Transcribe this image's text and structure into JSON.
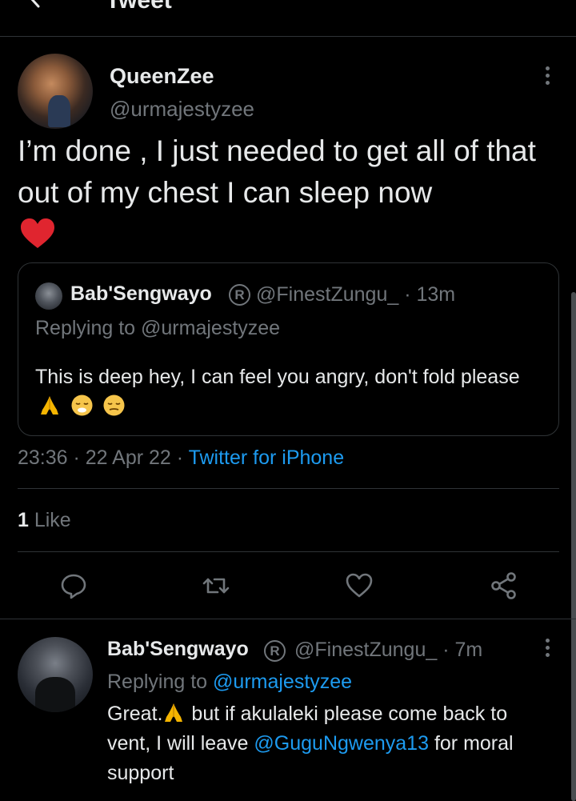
{
  "header": {
    "title": "Tweet"
  },
  "tweet": {
    "author_name": "QueenZee",
    "author_handle": "@urmajestyzee",
    "text": "I’m done , I just needed to get all of that out of my chest I can sleep now",
    "quoted": {
      "author_name": "Bab'Sengwayo",
      "registered_mark": "R",
      "handle_time": "@FinestZungu_ · 13m",
      "replying_to": "Replying to @urmajestyzee",
      "body": "This is deep hey, I can feel you angry, don't fold please"
    },
    "time": "23:36",
    "date": "22 Apr 22",
    "source": "Twitter for iPhone",
    "likes_count": "1",
    "likes_label": " Like"
  },
  "reply": {
    "author_name": "Bab'Sengwayo",
    "registered_mark": "R",
    "handle_time": "@FinestZungu_ · 7m",
    "replying_prefix": "Replying to ",
    "replying_mention": "@urmajestyzee",
    "body_part1": "Great.",
    "body_part2": " but if akulaleki please come back to vent, I will leave ",
    "body_mention": "@GuguNgwenya13",
    "body_part3": " for moral support"
  },
  "colors": {
    "background": "#000000",
    "text": "#e7e9ea",
    "muted": "#71767b",
    "accent": "#1d9bf0",
    "divider": "#2f3336"
  },
  "icons": [
    "back-arrow-icon",
    "more-vertical-icon",
    "heart-emoji",
    "folded-hands-emoji",
    "relieved-face-emoji",
    "reply-icon",
    "retweet-icon",
    "like-icon",
    "share-icon"
  ]
}
